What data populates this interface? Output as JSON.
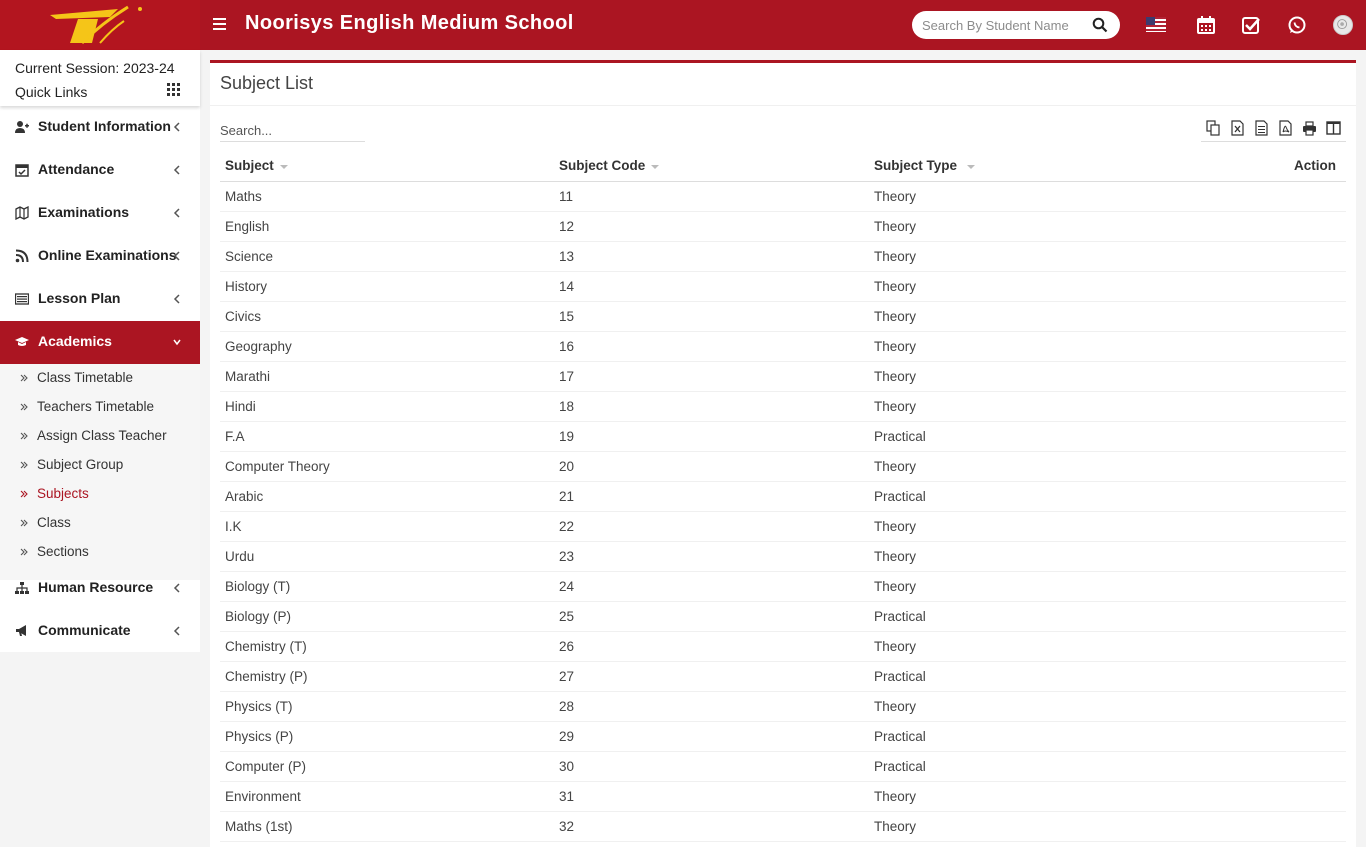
{
  "header": {
    "app_title": "Noorisys English Medium School",
    "search_placeholder": "Search By Student Name"
  },
  "sidebar": {
    "session_label": "Current Session: 2023-24",
    "quick_links_label": "Quick Links",
    "menu": [
      {
        "label": "Student Information",
        "icon": "user-plus-icon"
      },
      {
        "label": "Attendance",
        "icon": "calendar-check-icon"
      },
      {
        "label": "Examinations",
        "icon": "map-icon"
      },
      {
        "label": "Online Examinations",
        "icon": "rss-icon"
      },
      {
        "label": "Lesson Plan",
        "icon": "list-alt-icon"
      },
      {
        "label": "Academics",
        "icon": "graduation-cap-icon"
      },
      {
        "label": "Human Resource",
        "icon": "sitemap-icon"
      },
      {
        "label": "Communicate",
        "icon": "bullhorn-icon"
      }
    ],
    "academics_submenu": [
      {
        "label": "Class Timetable"
      },
      {
        "label": "Teachers Timetable"
      },
      {
        "label": "Assign Class Teacher"
      },
      {
        "label": "Subject Group"
      },
      {
        "label": "Subjects"
      },
      {
        "label": "Class"
      },
      {
        "label": "Sections"
      }
    ]
  },
  "main": {
    "title": "Subject List",
    "search_placeholder": "Search...",
    "columns": [
      "Subject",
      "Subject Code",
      "Subject Type",
      "Action"
    ],
    "rows": [
      [
        "Maths",
        "11",
        "Theory"
      ],
      [
        "English",
        "12",
        "Theory"
      ],
      [
        "Science",
        "13",
        "Theory"
      ],
      [
        "History",
        "14",
        "Theory"
      ],
      [
        "Civics",
        "15",
        "Theory"
      ],
      [
        "Geography",
        "16",
        "Theory"
      ],
      [
        "Marathi",
        "17",
        "Theory"
      ],
      [
        "Hindi",
        "18",
        "Theory"
      ],
      [
        "F.A",
        "19",
        "Practical"
      ],
      [
        "Computer Theory",
        "20",
        "Theory"
      ],
      [
        "Arabic",
        "21",
        "Practical"
      ],
      [
        "I.K",
        "22",
        "Theory"
      ],
      [
        "Urdu",
        "23",
        "Theory"
      ],
      [
        "Biology (T)",
        "24",
        "Theory"
      ],
      [
        "Biology (P)",
        "25",
        "Practical"
      ],
      [
        "Chemistry (T)",
        "26",
        "Theory"
      ],
      [
        "Chemistry (P)",
        "27",
        "Practical"
      ],
      [
        "Physics (T)",
        "28",
        "Theory"
      ],
      [
        "Physics (P)",
        "29",
        "Practical"
      ],
      [
        "Computer (P)",
        "30",
        "Practical"
      ],
      [
        "Environment",
        "31",
        "Theory"
      ],
      [
        "Maths (1st)",
        "32",
        "Theory"
      ]
    ]
  },
  "colors": {
    "brand": "#ab1522",
    "logo_yellow": "#f5c518"
  }
}
